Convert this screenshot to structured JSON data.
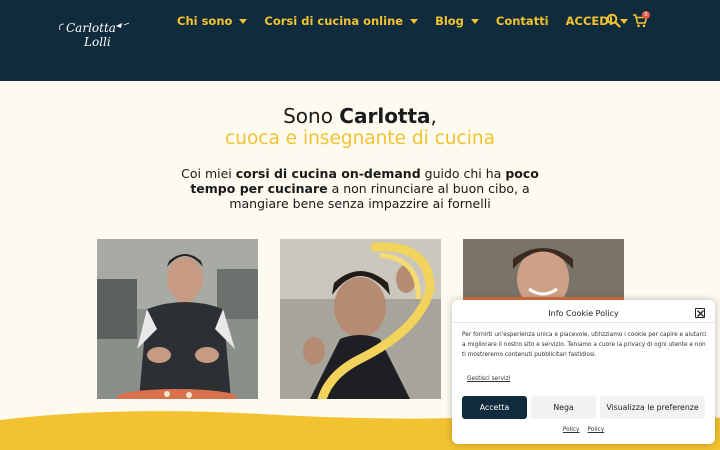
{
  "header": {
    "logo_line1": "Carlotta",
    "logo_line2": "Lolli",
    "nav": [
      {
        "label": "Chi sono",
        "has_caret": true
      },
      {
        "label": "Corsi di cucina online",
        "has_caret": true
      },
      {
        "label": "Blog",
        "has_caret": true
      },
      {
        "label": "Contatti",
        "has_caret": false
      },
      {
        "label": "ACCEDI",
        "has_caret": true
      }
    ],
    "cart_count": "0",
    "icons": [
      "search-icon",
      "cart-icon"
    ]
  },
  "hero": {
    "title_prefix": "Sono ",
    "title_name": "Carlotta",
    "title_suffix": ",",
    "subtitle": "cuoca e insegnante di cucina",
    "intro_1": "Coi miei ",
    "intro_2": "corsi di cucina on-demand",
    "intro_3": " guido chi ha ",
    "intro_4": "poco tempo per cucinare",
    "intro_5": " a non rinunciare al buon cibo, a mangiare bene senza impazzire ai fornelli"
  },
  "cookie": {
    "title": "Info Cookie Policy",
    "body": "Per fornirti un'esperienza unica e piacevole, utilizziamo i cookie per capire e aiutarci a migliorare il nostro sito e servizio. Teniamo a cuore la privacy di ogni utente e non ti mostreremo contenuti pubblicitari fastidiosi.",
    "manage": "Gestisci servizi",
    "accept": "Accetta",
    "deny": "Nega",
    "prefs": "Visualizza le preferenze",
    "link1": "Policy",
    "link2": "Policy"
  },
  "colors": {
    "header_bg": "#0f2b3c",
    "accent_yellow": "#f2c230",
    "page_bg": "#fdfaf0",
    "accept_bg": "#0f2b3c"
  }
}
